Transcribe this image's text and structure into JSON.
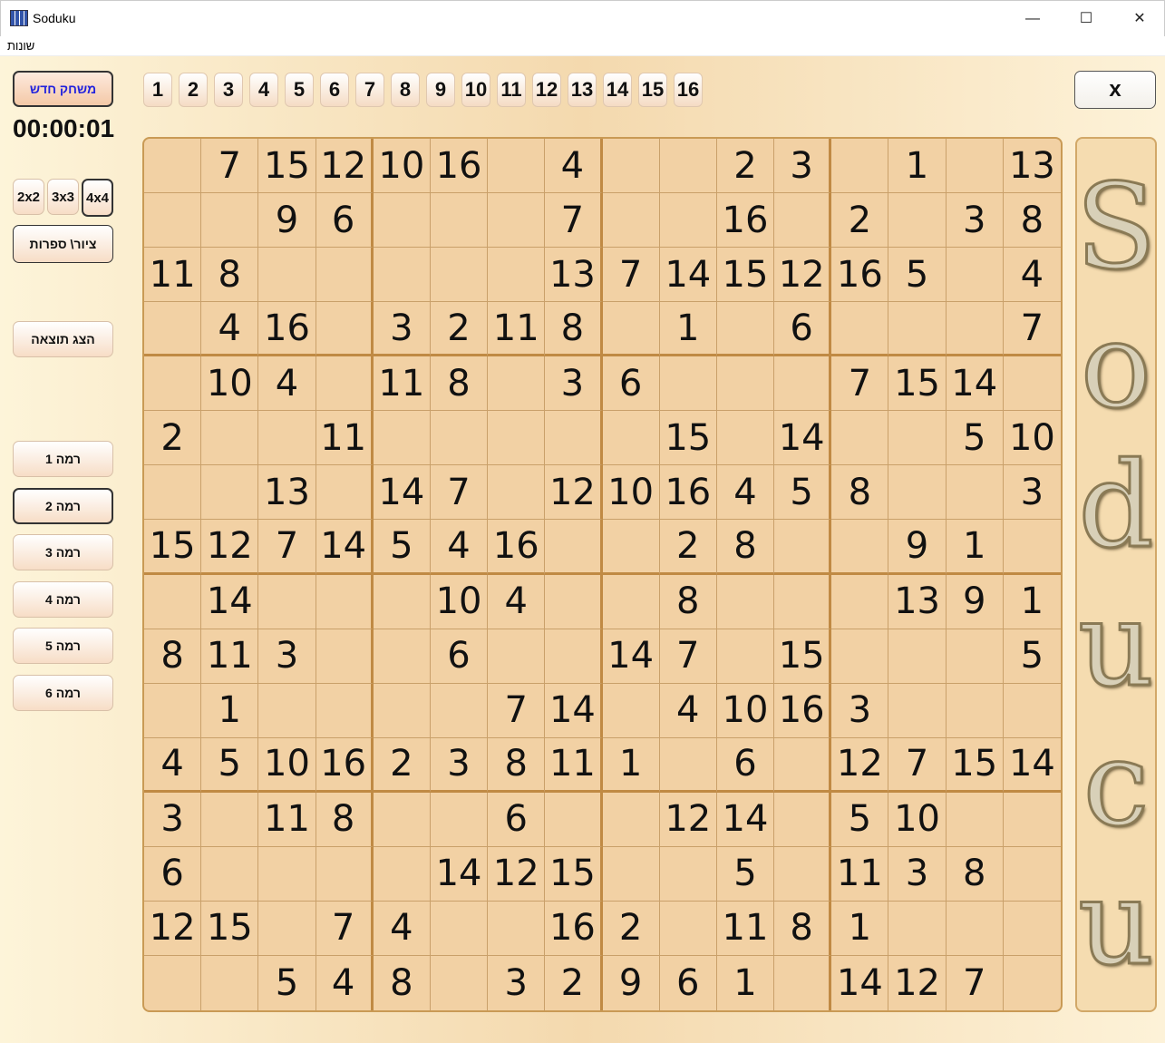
{
  "window": {
    "title": "Soduku",
    "minimize": "—",
    "maximize": "☐",
    "close": "✕"
  },
  "menu": {
    "misc": "שונות"
  },
  "left": {
    "new_game": "משחק חדש",
    "timer": "00:00:01",
    "sizes": [
      "2x2",
      "3x3",
      "4x4"
    ],
    "selected_size": "4x4",
    "draw_digits": "ציור\\ ספרות",
    "show_result": "הצג תוצאה",
    "levels": [
      "רמה 1",
      "רמה 2",
      "רמה 3",
      "רמה 4",
      "רמה 5",
      "רמה 6"
    ],
    "selected_level": 1
  },
  "palette": [
    "1",
    "2",
    "3",
    "4",
    "5",
    "6",
    "7",
    "8",
    "9",
    "10",
    "11",
    "12",
    "13",
    "14",
    "15",
    "16"
  ],
  "close_button": "x",
  "logo_text": "Soducu",
  "board": [
    [
      "",
      "7",
      "15",
      "12",
      "10",
      "16",
      "",
      "4",
      "",
      "",
      "2",
      "3",
      "",
      "1",
      "",
      "13"
    ],
    [
      "",
      "",
      "9",
      "6",
      "",
      "",
      "",
      "7",
      "",
      "",
      "16",
      "",
      "2",
      "",
      "3",
      "8"
    ],
    [
      "11",
      "8",
      "",
      "",
      "",
      "",
      "",
      "13",
      "7",
      "14",
      "15",
      "12",
      "16",
      "5",
      "",
      "4"
    ],
    [
      "",
      "4",
      "16",
      "",
      "3",
      "2",
      "11",
      "8",
      "",
      "1",
      "",
      "6",
      "",
      "",
      "",
      "7"
    ],
    [
      "",
      "10",
      "4",
      "",
      "11",
      "8",
      "",
      "3",
      "6",
      "",
      "",
      "",
      "7",
      "15",
      "14",
      ""
    ],
    [
      "2",
      "",
      "",
      "11",
      "",
      "",
      "",
      "",
      "",
      "15",
      "",
      "14",
      "",
      "",
      "5",
      "10"
    ],
    [
      "",
      "",
      "13",
      "",
      "14",
      "7",
      "",
      "12",
      "10",
      "16",
      "4",
      "5",
      "8",
      "",
      "",
      "3"
    ],
    [
      "15",
      "12",
      "7",
      "14",
      "5",
      "4",
      "16",
      "",
      "",
      "2",
      "8",
      "",
      "",
      "9",
      "1",
      ""
    ],
    [
      "",
      "14",
      "",
      "",
      "",
      "10",
      "4",
      "",
      "",
      "8",
      "",
      "",
      "",
      "13",
      "9",
      "1"
    ],
    [
      "8",
      "11",
      "3",
      "",
      "",
      "6",
      "",
      "",
      "14",
      "7",
      "",
      "15",
      "",
      "",
      "",
      "5"
    ],
    [
      "",
      "1",
      "",
      "",
      "",
      "",
      "7",
      "14",
      "",
      "4",
      "10",
      "16",
      "3",
      "",
      "",
      ""
    ],
    [
      "4",
      "5",
      "10",
      "16",
      "2",
      "3",
      "8",
      "11",
      "1",
      "",
      "6",
      "",
      "12",
      "7",
      "15",
      "14"
    ],
    [
      "3",
      "",
      "11",
      "8",
      "",
      "",
      "6",
      "",
      "",
      "12",
      "14",
      "",
      "5",
      "10",
      "",
      ""
    ],
    [
      "6",
      "",
      "",
      "",
      "",
      "14",
      "12",
      "15",
      "",
      "",
      "5",
      "",
      "11",
      "3",
      "8",
      ""
    ],
    [
      "12",
      "15",
      "",
      "7",
      "4",
      "",
      "",
      "16",
      "2",
      "",
      "11",
      "8",
      "1",
      "",
      "",
      ""
    ],
    [
      "",
      "",
      "5",
      "4",
      "8",
      "",
      "3",
      "2",
      "9",
      "6",
      "1",
      "",
      "14",
      "12",
      "7",
      ""
    ]
  ]
}
